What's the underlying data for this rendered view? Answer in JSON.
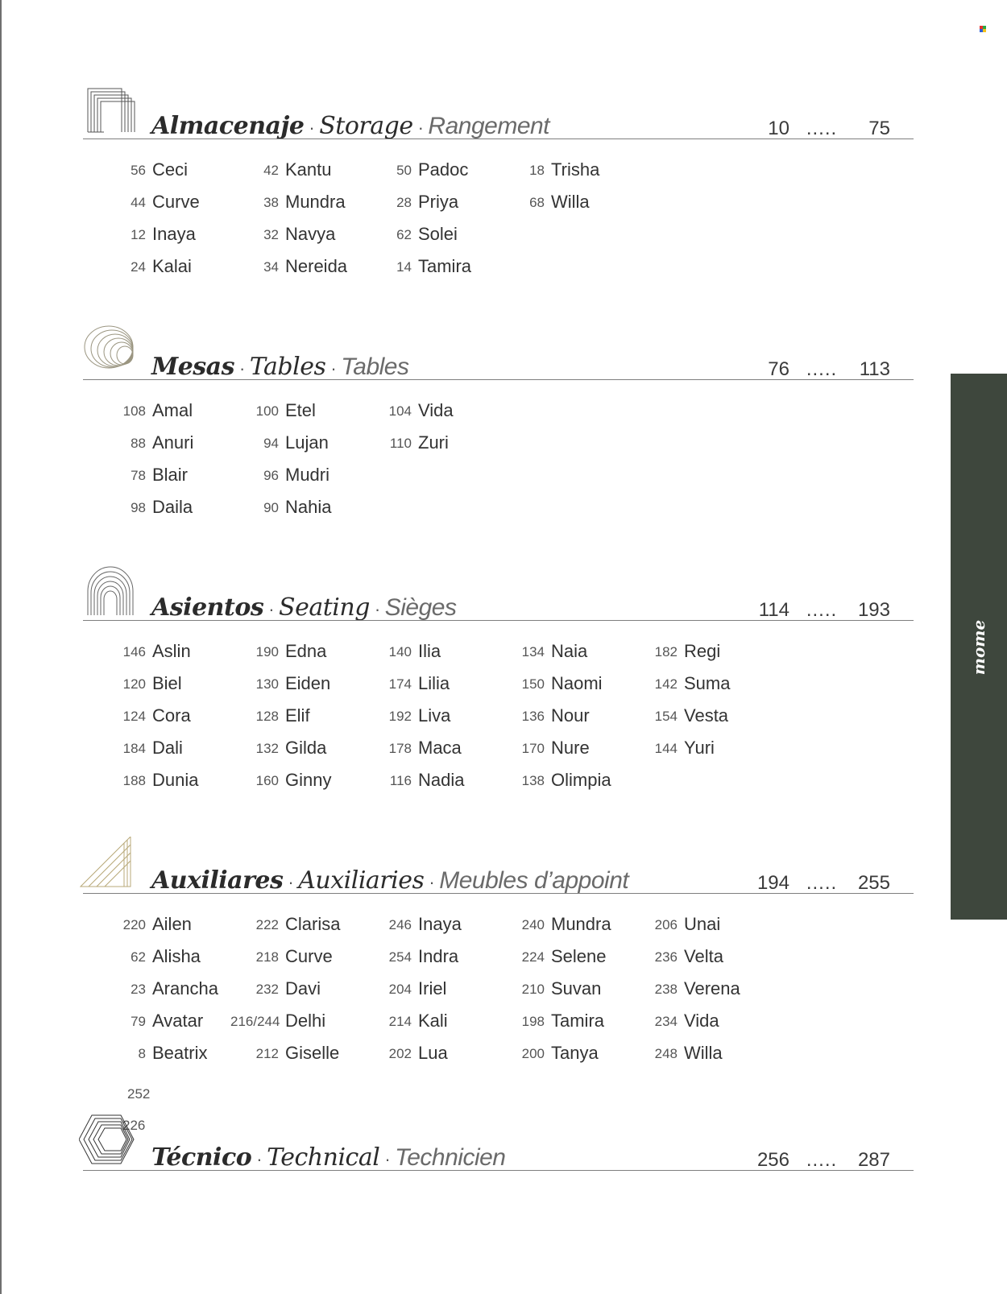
{
  "brand": "mome",
  "accent": "#3e473d",
  "sections": [
    {
      "id": "storage",
      "icon": "storage-lines-icon",
      "title_es": "Almacenaje",
      "title_en": "Storage",
      "title_fr": "Rangement",
      "sep": "·",
      "page_from": "10",
      "page_dots": ".....",
      "page_to": "75",
      "columns": [
        [
          {
            "num": "56",
            "name": "Ceci"
          },
          {
            "num": "44",
            "name": "Curve"
          },
          {
            "num": "12",
            "name": "Inaya"
          },
          {
            "num": "24",
            "name": "Kalai"
          }
        ],
        [
          {
            "num": "42",
            "name": "Kantu"
          },
          {
            "num": "38",
            "name": "Mundra"
          },
          {
            "num": "32",
            "name": "Navya"
          },
          {
            "num": "34",
            "name": "Nereida"
          }
        ],
        [
          {
            "num": "50",
            "name": "Padoc"
          },
          {
            "num": "28",
            "name": "Priya"
          },
          {
            "num": "62",
            "name": "Solei"
          },
          {
            "num": "14",
            "name": "Tamira"
          }
        ],
        [
          {
            "num": "18",
            "name": "Trisha"
          },
          {
            "num": "68",
            "name": "Willa"
          }
        ]
      ]
    },
    {
      "id": "tables",
      "icon": "tables-ovals-icon",
      "title_es": "Mesas",
      "title_en": "Tables",
      "title_fr": "Tables",
      "sep": "·",
      "page_from": "76",
      "page_dots": ".....",
      "page_to": "113",
      "columns": [
        [
          {
            "num": "108",
            "name": "Amal"
          },
          {
            "num": "88",
            "name": "Anuri"
          },
          {
            "num": "78",
            "name": "Blair"
          },
          {
            "num": "98",
            "name": "Daila"
          }
        ],
        [
          {
            "num": "100",
            "name": "Etel"
          },
          {
            "num": "94",
            "name": "Lujan"
          },
          {
            "num": "96",
            "name": "Mudri"
          },
          {
            "num": "90",
            "name": "Nahia"
          }
        ],
        [
          {
            "num": "104",
            "name": "Vida"
          },
          {
            "num": "110",
            "name": "Zuri"
          }
        ]
      ]
    },
    {
      "id": "seating",
      "icon": "seating-arches-icon",
      "title_es": "Asientos",
      "title_en": "Seating",
      "title_fr": "Sièges",
      "sep": "·",
      "page_from": "114",
      "page_dots": ".....",
      "page_to": "193",
      "columns": [
        [
          {
            "num": "146",
            "name": "Aslin"
          },
          {
            "num": "120",
            "name": "Biel"
          },
          {
            "num": "124",
            "name": "Cora"
          },
          {
            "num": "184",
            "name": "Dali"
          },
          {
            "num": "188",
            "name": "Dunia"
          }
        ],
        [
          {
            "num": "190",
            "name": "Edna"
          },
          {
            "num": "130",
            "name": "Eiden"
          },
          {
            "num": "128",
            "name": "Elif"
          },
          {
            "num": "132",
            "name": "Gilda"
          },
          {
            "num": "160",
            "name": "Ginny"
          }
        ],
        [
          {
            "num": "140",
            "name": "Ilia"
          },
          {
            "num": "174",
            "name": "Lilia"
          },
          {
            "num": "192",
            "name": "Liva"
          },
          {
            "num": "178",
            "name": "Maca"
          },
          {
            "num": "116",
            "name": "Nadia"
          }
        ],
        [
          {
            "num": "134",
            "name": "Naia"
          },
          {
            "num": "150",
            "name": "Naomi"
          },
          {
            "num": "136",
            "name": "Nour"
          },
          {
            "num": "170",
            "name": "Nure"
          },
          {
            "num": "138",
            "name": "Olimpia"
          }
        ],
        [
          {
            "num": "182",
            "name": "Regi"
          },
          {
            "num": "142",
            "name": "Suma"
          },
          {
            "num": "154",
            "name": "Vesta"
          },
          {
            "num": "144",
            "name": "Yuri"
          }
        ]
      ]
    },
    {
      "id": "auxiliaries",
      "icon": "auxiliaries-triangles-icon",
      "title_es": "Auxiliares",
      "title_en": "Auxiliaries",
      "title_fr": "Meubles d’appoint",
      "sep": "·",
      "page_from": "194",
      "page_dots": ".....",
      "page_to": "255",
      "columns": [
        [
          {
            "num": "220",
            "name": "Ailen"
          },
          {
            "num": "62",
            "name": "Alisha"
          },
          {
            "num": "23",
            "name": "Arancha"
          },
          {
            "num": "79",
            "name": "Avatar"
          },
          {
            "num": "8",
            "name": "Beatrix"
          }
        ],
        [
          {
            "num": "222",
            "name": "Clarisa"
          },
          {
            "num": "218",
            "name": "Curve"
          },
          {
            "num": "232",
            "name": "Davi"
          },
          {
            "num": "216/244",
            "name": "Delhi"
          },
          {
            "num": "212",
            "name": "Giselle"
          }
        ],
        [
          {
            "num": "246",
            "name": "Inaya"
          },
          {
            "num": "254",
            "name": "Indra"
          },
          {
            "num": "204",
            "name": "Iriel"
          },
          {
            "num": "214",
            "name": "Kali"
          },
          {
            "num": "202",
            "name": "Lua"
          }
        ],
        [
          {
            "num": "240",
            "name": "Mundra"
          },
          {
            "num": "224",
            "name": "Selene"
          },
          {
            "num": "210",
            "name": "Suvan"
          },
          {
            "num": "198",
            "name": "Tamira"
          },
          {
            "num": "200",
            "name": "Tanya"
          }
        ],
        [
          {
            "num": "206",
            "name": "Unai"
          },
          {
            "num": "236",
            "name": "Velta"
          },
          {
            "num": "238",
            "name": "Verena"
          },
          {
            "num": "234",
            "name": "Vida"
          },
          {
            "num": "248",
            "name": "Willa"
          }
        ]
      ],
      "stray_numbers": [
        "252",
        "226"
      ]
    },
    {
      "id": "technical",
      "icon": "technical-hexagons-icon",
      "title_es": "Técnico",
      "title_en": "Technical",
      "title_fr": "Technicien",
      "sep": "·",
      "page_from": "256",
      "page_dots": ".....",
      "page_to": "287",
      "columns": []
    }
  ]
}
